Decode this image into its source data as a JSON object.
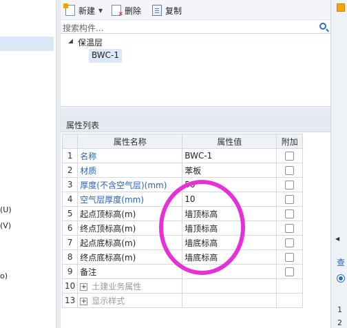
{
  "left_panel": {
    "items": [
      "(U)",
      "(V)",
      "o)"
    ]
  },
  "toolbar": {
    "new_label": "新建",
    "delete_label": "删除",
    "copy_label": "复制"
  },
  "search": {
    "placeholder": "搜索构件..."
  },
  "tree": {
    "root_label": "保温层",
    "child_label": "BWC-1"
  },
  "props": {
    "title": "属性列表",
    "headers": {
      "name": "属性名称",
      "value": "属性值",
      "extra": "附加"
    },
    "rows": [
      {
        "num": "1",
        "name": "名称",
        "value": "BWC-1"
      },
      {
        "num": "2",
        "name": "材质",
        "value": "苯板"
      },
      {
        "num": "3",
        "name": "厚度(不含空气层)(mm)",
        "value": "50"
      },
      {
        "num": "4",
        "name": "空气层厚度(mm)",
        "value": "10"
      },
      {
        "num": "5",
        "name": "起点顶标高(m)",
        "value": "墙顶标高"
      },
      {
        "num": "6",
        "name": "终点顶标高(m)",
        "value": "墙顶标高"
      },
      {
        "num": "7",
        "name": "起点底标高(m)",
        "value": "墙底标高"
      },
      {
        "num": "8",
        "name": "终点底标高(m)",
        "value": "墙底标高"
      },
      {
        "num": "9",
        "name": "备注",
        "value": ""
      },
      {
        "num": "10",
        "name": "土建业务属性",
        "value": ""
      },
      {
        "num": "13",
        "name": "显示样式",
        "value": ""
      }
    ]
  },
  "right_panel": {
    "query_label": "查",
    "rows": [
      "1",
      "2"
    ]
  },
  "colors": {
    "accent_blue": "#2a62b8",
    "annotation_magenta": "#e532d8",
    "selection_bg": "#dce8f8"
  }
}
